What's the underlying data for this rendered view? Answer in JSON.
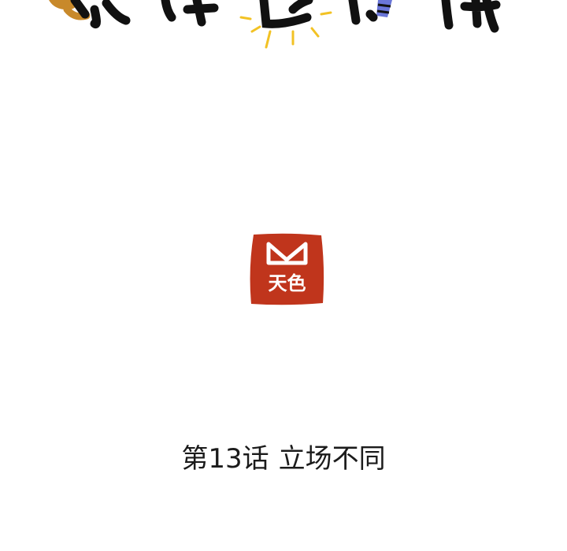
{
  "logo": {
    "text": "天色",
    "color": "#c0351c",
    "text_color": "#ffffff"
  },
  "chapter": {
    "number_label": "第13话",
    "title": "立场不同"
  },
  "title_art": {
    "colors": [
      "#111111",
      "#c8892a",
      "#f2c224",
      "#6a76d8"
    ]
  }
}
